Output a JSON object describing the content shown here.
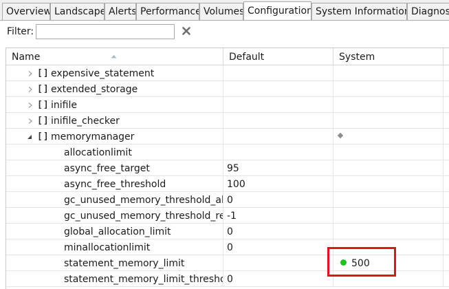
{
  "tabs": [
    {
      "label": "Overview",
      "active": false
    },
    {
      "label": "Landscape",
      "active": false
    },
    {
      "label": "Alerts",
      "active": false
    },
    {
      "label": "Performance",
      "active": false
    },
    {
      "label": "Volumes",
      "active": false
    },
    {
      "label": "Configuration",
      "active": true
    },
    {
      "label": "System Information",
      "active": false
    },
    {
      "label": "Diagnosi",
      "active": false
    }
  ],
  "filter": {
    "label": "Filter:",
    "value": "",
    "clear_icon": "close-icon"
  },
  "table": {
    "columns": {
      "name": "Name",
      "default": "Default",
      "system": "System"
    },
    "sort_icon": "sort-ascending-icon",
    "rows": [
      {
        "name": "expensive_statement",
        "default": "",
        "system": "",
        "level": 0,
        "expander": "collapsed"
      },
      {
        "name": "extended_storage",
        "default": "",
        "system": "",
        "level": 0,
        "expander": "collapsed"
      },
      {
        "name": "inifile",
        "default": "",
        "system": "",
        "level": 0,
        "expander": "collapsed"
      },
      {
        "name": "inifile_checker",
        "default": "",
        "system": "",
        "level": 0,
        "expander": "collapsed"
      },
      {
        "name": "memorymanager",
        "default": "",
        "system": "",
        "level": 0,
        "expander": "expanded",
        "system_marker": "diamond-icon"
      },
      {
        "name": "allocationlimit",
        "default": "",
        "system": "",
        "level": 1
      },
      {
        "name": "async_free_target",
        "default": "95",
        "system": "",
        "level": 1
      },
      {
        "name": "async_free_threshold",
        "default": "100",
        "system": "",
        "level": 1
      },
      {
        "name": "gc_unused_memory_threshold_abs",
        "default": "0",
        "system": "",
        "level": 1
      },
      {
        "name": "gc_unused_memory_threshold_rel",
        "default": "-1",
        "system": "",
        "level": 1
      },
      {
        "name": "global_allocation_limit",
        "default": "0",
        "system": "",
        "level": 1
      },
      {
        "name": "minallocationlimit",
        "default": "0",
        "system": "",
        "level": 1
      },
      {
        "name": "statement_memory_limit",
        "default": "",
        "system": "500",
        "level": 1,
        "system_status": "green-dot-icon",
        "highlighted": true
      },
      {
        "name": "statement_memory_limit_threshold",
        "default": "0",
        "system": "",
        "level": 1
      }
    ]
  },
  "colors": {
    "highlight": "#e0141e",
    "status_dot": "#1ec31e"
  }
}
